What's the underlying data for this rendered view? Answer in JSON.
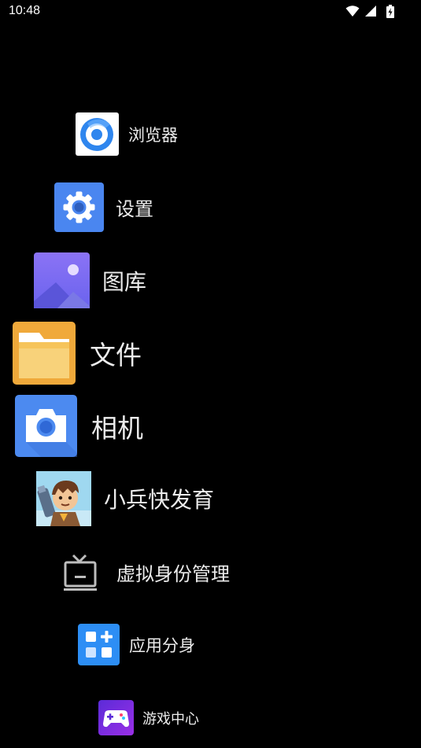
{
  "status_bar": {
    "time": "10:48",
    "icons": [
      "wifi-icon",
      "cellular-signal-icon",
      "battery-charging-icon"
    ]
  },
  "apps": [
    {
      "id": "browser",
      "label": "浏览器",
      "icon": "browser-icon"
    },
    {
      "id": "settings",
      "label": "设置",
      "icon": "gear-icon"
    },
    {
      "id": "gallery",
      "label": "图库",
      "icon": "gallery-icon"
    },
    {
      "id": "files",
      "label": "文件",
      "icon": "folder-icon"
    },
    {
      "id": "camera",
      "label": "相机",
      "icon": "camera-icon"
    },
    {
      "id": "game",
      "label": "小兵快发育",
      "icon": "soldier-game-icon"
    },
    {
      "id": "virtual-identity",
      "label": "虚拟身份管理",
      "icon": "tv-icon"
    },
    {
      "id": "app-clone",
      "label": "应用分身",
      "icon": "app-grid-icon"
    },
    {
      "id": "game-center",
      "label": "游戏中心",
      "icon": "gamepad-icon"
    }
  ],
  "colors": {
    "background": "#000000",
    "label": "#ececec",
    "settings_blue": "#4a86f0",
    "gallery_purple": "#7b6cf2",
    "folder_yellow": "#f6c14a",
    "camera_blue": "#4c8af0",
    "app_clone_blue": "#2d8ef5",
    "game_center_purple": "#7a2fe0"
  }
}
